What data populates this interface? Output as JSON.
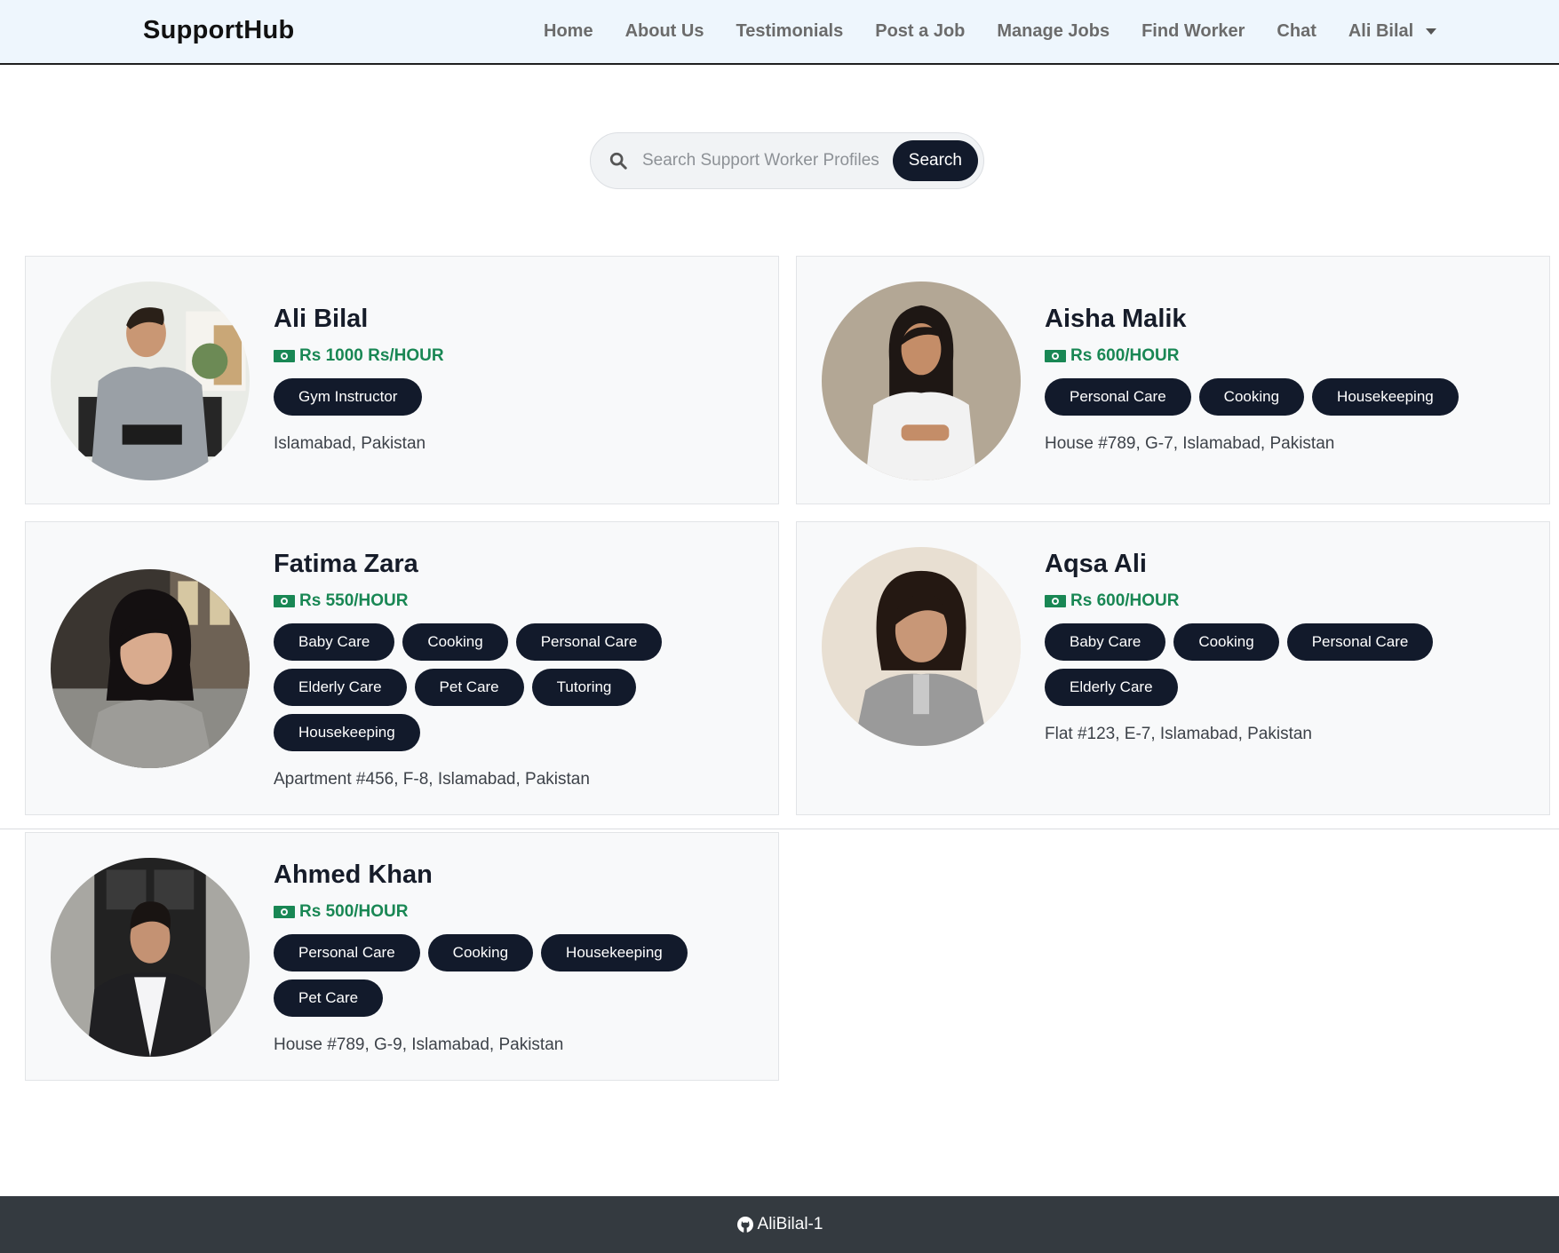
{
  "brand": "SupportHub",
  "nav": {
    "items": [
      {
        "label": "Home"
      },
      {
        "label": "About Us"
      },
      {
        "label": "Testimonials"
      },
      {
        "label": "Post a Job"
      },
      {
        "label": "Manage Jobs"
      },
      {
        "label": "Find Worker"
      },
      {
        "label": "Chat"
      }
    ],
    "user": "Ali Bilal"
  },
  "search": {
    "placeholder": "Search Support Worker Profiles",
    "button": "Search"
  },
  "workers": [
    {
      "name": "Ali Bilal",
      "rate": "Rs 1000 Rs/HOUR",
      "tags": [
        "Gym Instructor"
      ],
      "address": "Islamabad, Pakistan"
    },
    {
      "name": "Aisha Malik",
      "rate": "Rs 600/HOUR",
      "tags": [
        "Personal Care",
        "Cooking",
        "Housekeeping"
      ],
      "address": "House #789, G-7, Islamabad, Pakistan"
    },
    {
      "name": "Fatima Zara",
      "rate": "Rs 550/HOUR",
      "tags": [
        "Baby Care",
        "Cooking",
        "Personal Care",
        "Elderly Care",
        "Pet Care",
        "Tutoring",
        "Housekeeping"
      ],
      "address": "Apartment #456, F-8, Islamabad, Pakistan"
    },
    {
      "name": "Aqsa Ali",
      "rate": "Rs 600/HOUR",
      "tags": [
        "Baby Care",
        "Cooking",
        "Personal Care",
        "Elderly Care"
      ],
      "address": "Flat #123, E-7, Islamabad, Pakistan"
    },
    {
      "name": "Ahmed Khan",
      "rate": "Rs 500/HOUR",
      "tags": [
        "Personal Care",
        "Cooking",
        "Housekeeping",
        "Pet Care"
      ],
      "address": "House #789, G-9, Islamabad, Pakistan"
    }
  ],
  "footer": {
    "github_user": "AliBilal-1",
    "icon": "github-icon"
  },
  "colors": {
    "navbar_bg": "#eef6fd",
    "tag_bg": "#121a2b",
    "rate_green": "#198754",
    "footer_bg": "#343a40"
  }
}
